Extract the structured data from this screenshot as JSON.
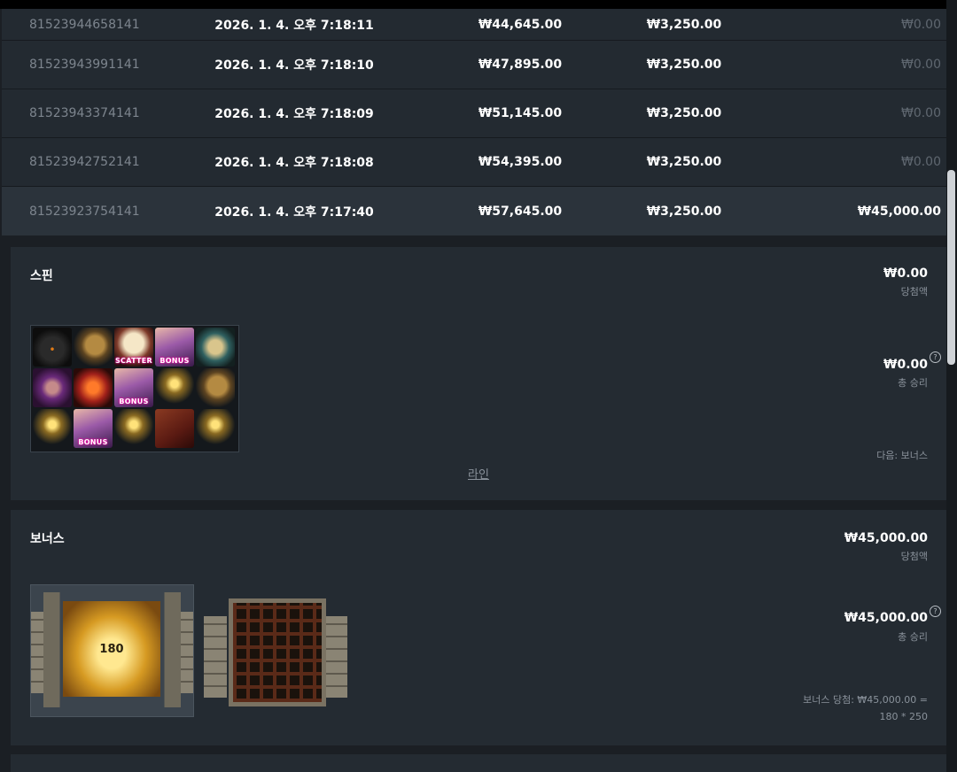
{
  "rows": [
    {
      "id": "81523944658141",
      "time": "2026. 1. 4. 오후 7:18:11",
      "balance": "₩44,645.00",
      "bet": "₩3,250.00",
      "win": "₩0.00",
      "highlight": false
    },
    {
      "id": "81523943991141",
      "time": "2026. 1. 4. 오후 7:18:10",
      "balance": "₩47,895.00",
      "bet": "₩3,250.00",
      "win": "₩0.00",
      "highlight": false
    },
    {
      "id": "81523943374141",
      "time": "2026. 1. 4. 오후 7:18:09",
      "balance": "₩51,145.00",
      "bet": "₩3,250.00",
      "win": "₩0.00",
      "highlight": false
    },
    {
      "id": "81523942752141",
      "time": "2026. 1. 4. 오후 7:18:08",
      "balance": "₩54,395.00",
      "bet": "₩3,250.00",
      "win": "₩0.00",
      "highlight": false
    },
    {
      "id": "81523923754141",
      "time": "2026. 1. 4. 오후 7:17:40",
      "balance": "₩57,645.00",
      "bet": "₩3,250.00",
      "win": "₩45,000.00",
      "highlight": true
    }
  ],
  "spin": {
    "title": "스핀",
    "win_amount": "₩0.00",
    "win_label": "당첨액",
    "total_amount": "₩0.00",
    "total_label": "총 승리",
    "next": "다음: 보너스",
    "lines_link": "라인",
    "help_icon": "?",
    "reels": [
      [
        "wolf",
        "bell",
        "scatter",
        "bonus",
        "skull"
      ],
      [
        "mask",
        "demon",
        "bonus",
        "candle",
        "bell"
      ],
      [
        "candle",
        "bonus",
        "candle",
        "book",
        "candle"
      ]
    ],
    "scatter_text": "SCATTER",
    "bonus_text": "BONUS"
  },
  "bonus": {
    "title": "보너스",
    "win_amount": "₩45,000.00",
    "win_label": "당첨액",
    "total_amount": "₩45,000.00",
    "total_label": "총 승리",
    "help_icon": "?",
    "note_line1": "보너스 당첨: ₩45,000.00 =",
    "note_line2": "180 * 250",
    "door_value": "180"
  }
}
